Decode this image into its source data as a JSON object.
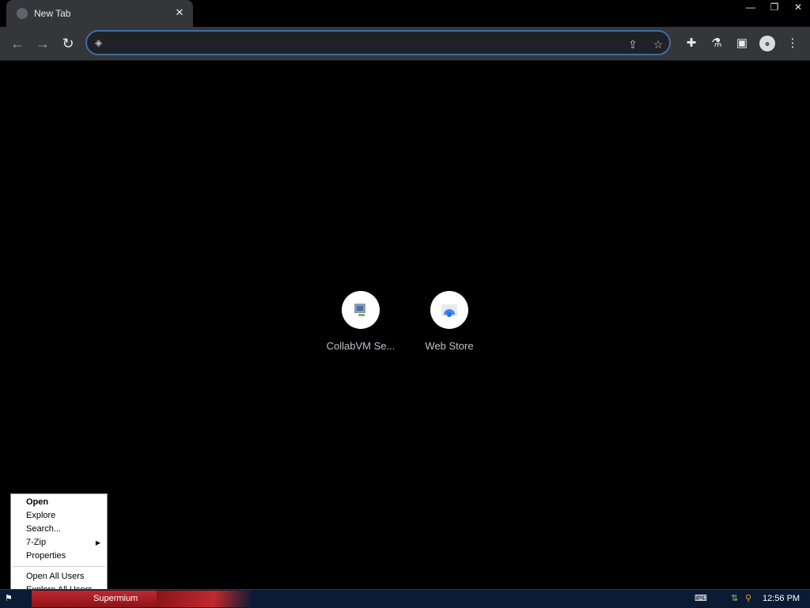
{
  "browser": {
    "tab_title": "New Tab",
    "tab_close": "✕",
    "window_controls": {
      "minimize": "—",
      "restore": "❐",
      "close": "✕"
    },
    "omnibox": {
      "value": "",
      "placeholder": ""
    }
  },
  "shortcuts": [
    {
      "label": "CollabVM Se...",
      "icon": "collabvm-icon"
    },
    {
      "label": "Web Store",
      "icon": "web-store-icon"
    }
  ],
  "context_menu": {
    "items": [
      {
        "label": "Open",
        "bold": true
      },
      {
        "label": "Explore"
      },
      {
        "label": "Search..."
      },
      {
        "label": "7-Zip",
        "submenu": true
      },
      {
        "label": "Properties"
      },
      {
        "label": "Open All Users"
      },
      {
        "label": "Explore All Users"
      }
    ]
  },
  "taskbar": {
    "task_label": "Supermium",
    "clock": "12:56 PM"
  },
  "colors": {
    "accent": "#3b6ea8",
    "toolbar": "#35363a",
    "taskbar": "#0b1b34",
    "task": "#c0282e"
  }
}
